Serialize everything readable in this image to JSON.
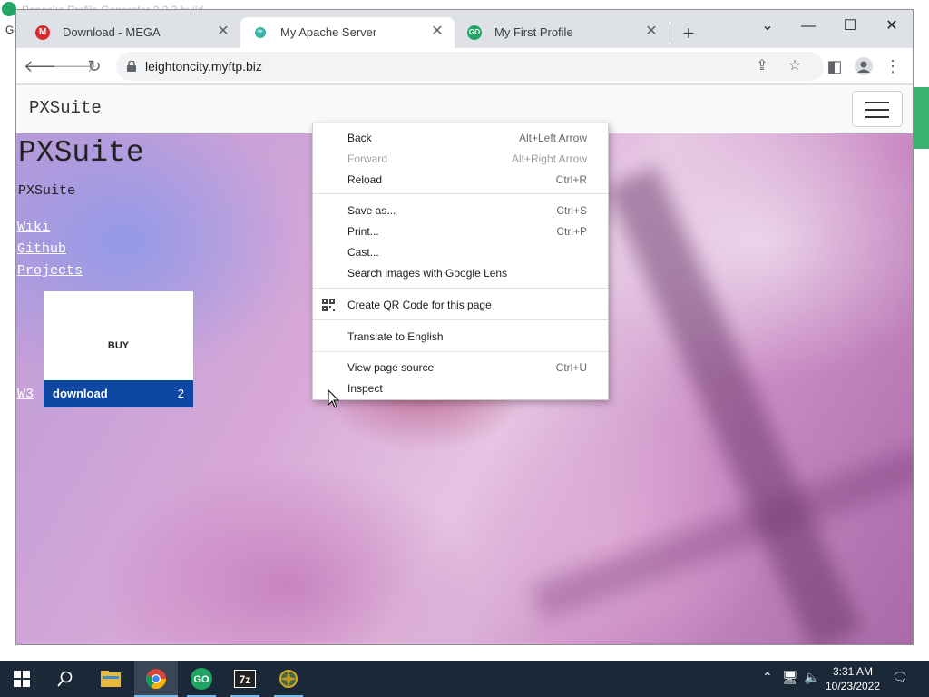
{
  "background_window": {
    "title": "Pancake Profile Generator 2.2.3 build",
    "letters": "Go"
  },
  "chrome": {
    "tabs": [
      {
        "label": "Download - MEGA",
        "icon": "mega-icon",
        "active": false
      },
      {
        "label": "My Apache Server",
        "icon": "globe-icon",
        "active": true
      },
      {
        "label": "My First Profile",
        "icon": "greenorbit-icon",
        "active": false
      }
    ],
    "new_tab_glyph": "+",
    "url": "leightoncity.myftp.biz"
  },
  "page": {
    "brand": "PXSuite",
    "title": "PXSuite",
    "subtitle": "PXSuite",
    "links": [
      "Wiki",
      "Github",
      "Projects",
      "W3"
    ],
    "card": {
      "buy_label": "BUY",
      "download_label": "download",
      "count": "2"
    }
  },
  "context_menu": {
    "items": [
      {
        "label": "Back",
        "shortcut": "Alt+Left Arrow",
        "disabled": false
      },
      {
        "label": "Forward",
        "shortcut": "Alt+Right Arrow",
        "disabled": true
      },
      {
        "label": "Reload",
        "shortcut": "Ctrl+R",
        "disabled": false
      },
      {
        "label": "Save as...",
        "shortcut": "Ctrl+S",
        "disabled": false
      },
      {
        "label": "Print...",
        "shortcut": "Ctrl+P",
        "disabled": false
      },
      {
        "label": "Cast...",
        "shortcut": "",
        "disabled": false
      },
      {
        "label": "Search images with Google Lens",
        "shortcut": "",
        "disabled": false
      },
      {
        "label": "Create QR Code for this page",
        "shortcut": "",
        "disabled": false
      },
      {
        "label": "Translate to English",
        "shortcut": "",
        "disabled": false
      },
      {
        "label": "View page source",
        "shortcut": "Ctrl+U",
        "disabled": false
      },
      {
        "label": "Inspect",
        "shortcut": "",
        "disabled": false
      }
    ]
  },
  "taskbar": {
    "time": "3:31 AM",
    "date": "10/23/2022",
    "pinned": [
      "start-icon",
      "search-icon",
      "file-explorer-icon",
      "chrome-icon",
      "greenorbit-icon",
      "7zip-icon",
      "app-icon"
    ]
  },
  "colors": {
    "card_footer": "#0d47a1",
    "taskbar": "#1b2838",
    "greenorbit": "#1fa463",
    "mega": "#d9272e"
  }
}
